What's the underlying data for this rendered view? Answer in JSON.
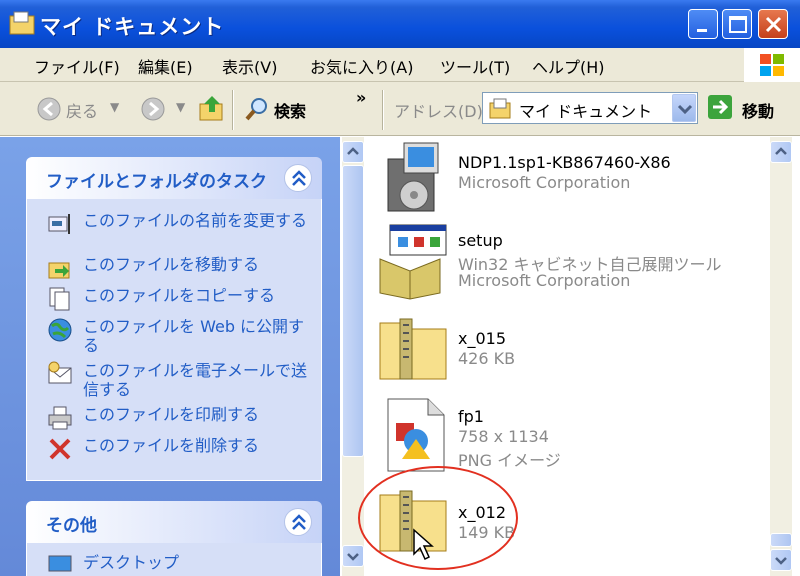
{
  "window": {
    "title": "マイ ドキュメント",
    "minimize_icon": "minimize-icon",
    "maximize_icon": "maximize-icon",
    "close_icon": "close-icon"
  },
  "menubar": {
    "items": [
      "ファイル(F)",
      "編集(E)",
      "表示(V)",
      "お気に入り(A)",
      "ツール(T)",
      "ヘルプ(H)"
    ]
  },
  "toolbar": {
    "back_label": "戻る",
    "search_label": "検索",
    "more": "»",
    "address_label": "アドレス(D)",
    "address_value": "マイ ドキュメント",
    "go_label": "移動"
  },
  "tasks_panel": {
    "title": "ファイルとフォルダのタスク",
    "tasks": [
      {
        "label": "このファイルの名前を変更する",
        "icon": "rename-icon"
      },
      {
        "label": "このファイルを移動する",
        "icon": "move-icon"
      },
      {
        "label": "このファイルをコピーする",
        "icon": "copy-icon"
      },
      {
        "label": "このファイルを Web に公開する",
        "icon": "web-publish-icon"
      },
      {
        "label": "このファイルを電子メールで送信する",
        "icon": "email-icon"
      },
      {
        "label": "このファイルを印刷する",
        "icon": "print-icon"
      },
      {
        "label": "このファイルを削除する",
        "icon": "delete-icon"
      }
    ]
  },
  "other_panel": {
    "title": "その他",
    "items": [
      {
        "label": "デスクトップ",
        "icon": "desktop-icon"
      }
    ]
  },
  "files": [
    {
      "name": "NDP1.1sp1-KB867460-X86",
      "lines": [
        "Microsoft Corporation"
      ],
      "icon": "installer-icon"
    },
    {
      "name": "setup",
      "lines": [
        "Win32 キャビネット自己展開ツール",
        "Microsoft Corporation"
      ],
      "icon": "setup-box-icon"
    },
    {
      "name": "x_015",
      "lines": [
        "426 KB"
      ],
      "icon": "zip-folder-icon"
    },
    {
      "name": "fp1",
      "lines": [
        "758 x 1134",
        "PNG イメージ"
      ],
      "icon": "png-image-icon"
    },
    {
      "name": "x_012",
      "lines": [
        "149 KB"
      ],
      "icon": "zip-folder-icon"
    }
  ],
  "colors": {
    "titlebar": "#0a50dc",
    "task_link": "#215dc6",
    "highlight_circle": "#e23020"
  }
}
